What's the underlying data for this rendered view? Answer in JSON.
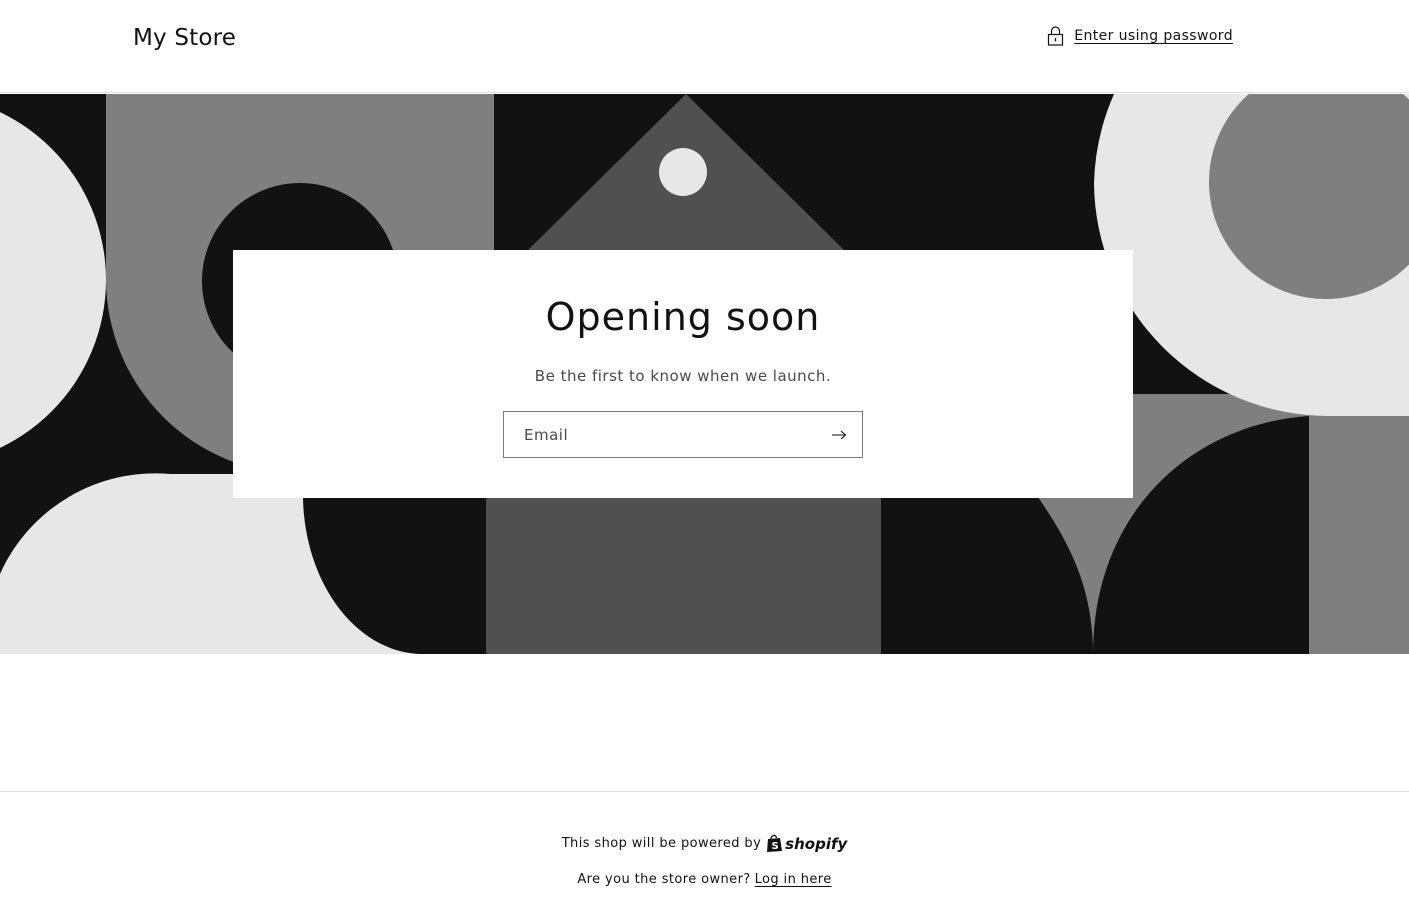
{
  "header": {
    "store_title": "My Store",
    "password_link": "Enter using password",
    "password_icon": "lock-icon"
  },
  "main": {
    "title": "Opening soon",
    "subtitle": "Be the first to know when we launch.",
    "email": {
      "placeholder": "Email",
      "value": ""
    },
    "submit_icon": "arrow-right-icon"
  },
  "footer": {
    "powered_text": "This shop will be powered by",
    "brand_name": "shopify",
    "owner_text": "Are you the store owner?",
    "login_link": "Log in here"
  },
  "colors": {
    "black": "#121212",
    "dark_gray": "#505050",
    "mid_gray": "#7f7f7f",
    "light_gray": "#e7e7e7",
    "white": "#ffffff"
  }
}
